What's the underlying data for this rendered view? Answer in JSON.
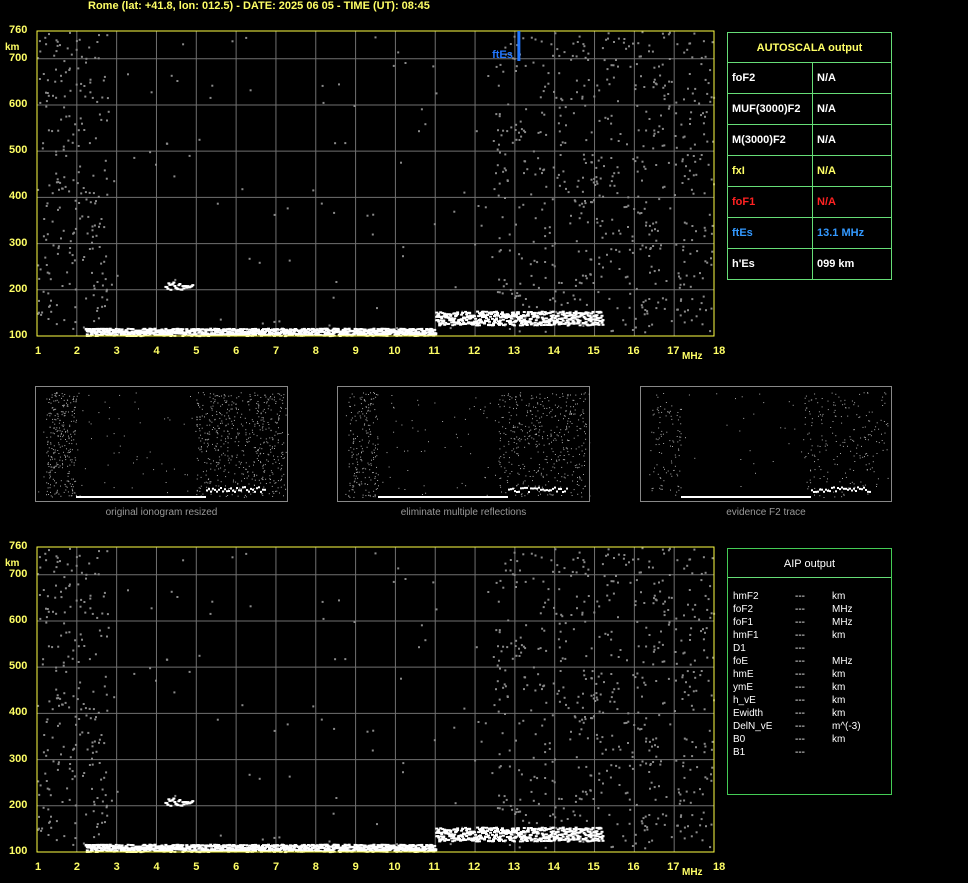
{
  "title": "Rome (lat: +41.8, lon: 012.5) - DATE: 2025 06 05 - TIME (UT): 08:45",
  "axes": {
    "y_unit": "km",
    "x_unit": "MHz",
    "y_ticks": [
      "760",
      "700",
      "600",
      "500",
      "400",
      "300",
      "200",
      "100"
    ],
    "x_ticks": [
      "1",
      "2",
      "3",
      "4",
      "5",
      "6",
      "7",
      "8",
      "9",
      "10",
      "11",
      "12",
      "13",
      "14",
      "15",
      "16",
      "17",
      "18"
    ]
  },
  "colors": {
    "label": "#ffff66",
    "grid": "#707070",
    "frame": "#ffff44",
    "fte": "#2277ff",
    "red": "#ff2222",
    "green": "#66dd77"
  },
  "chart_data": [
    {
      "type": "scatter",
      "name": "ionogram",
      "x_range": [
        1,
        18
      ],
      "y_range": [
        100,
        760
      ],
      "grid": true,
      "annotations": [
        {
          "label": "ftEs",
          "x": 13.1
        }
      ],
      "traces": [
        {
          "x_from": 2.2,
          "x_to": 11.0,
          "height_km": 110
        },
        {
          "x_from": 11.0,
          "x_to": 15.2,
          "height_km": 140
        },
        {
          "x_from": 4.2,
          "x_to": 4.9,
          "height_km": 210
        }
      ]
    },
    {
      "type": "scatter",
      "name": "ionogram-aip",
      "x_range": [
        1,
        18
      ],
      "y_range": [
        100,
        760
      ],
      "grid": true,
      "traces": [
        {
          "x_from": 2.2,
          "x_to": 11.0,
          "height_km": 110
        },
        {
          "x_from": 11.0,
          "x_to": 15.2,
          "height_km": 140
        },
        {
          "x_from": 4.2,
          "x_to": 4.9,
          "height_km": 210
        }
      ]
    }
  ],
  "autoscala": {
    "heading": "AUTOSCALA output",
    "rows": [
      {
        "label": "foF2",
        "value": "N/A",
        "color": "#ffffff"
      },
      {
        "label": "MUF(3000)F2",
        "value": "N/A",
        "color": "#ffffff"
      },
      {
        "label": "M(3000)F2",
        "value": "N/A",
        "color": "#ffffff"
      },
      {
        "label": "fxI",
        "value": "N/A",
        "color": "#ffff66"
      },
      {
        "label": "foF1",
        "value": "N/A",
        "color": "#ff2222"
      },
      {
        "label": "ftEs",
        "value": "13.1  MHz",
        "color": "#3399ff"
      },
      {
        "label": "h'Es",
        "value": "099      km",
        "color": "#ffffff"
      }
    ]
  },
  "thumbnails": [
    {
      "caption": "original ionogram resized"
    },
    {
      "caption": "eliminate multiple reflections"
    },
    {
      "caption": "evidence F2 trace"
    }
  ],
  "aip": {
    "heading": "AIP output",
    "rows": [
      {
        "name": "hmF2",
        "value": "---",
        "unit": "km"
      },
      {
        "name": "foF2",
        "value": "---",
        "unit": "MHz"
      },
      {
        "name": "foF1",
        "value": "---",
        "unit": "MHz"
      },
      {
        "name": "hmF1",
        "value": "---",
        "unit": "km"
      },
      {
        "name": "D1",
        "value": "---",
        "unit": ""
      },
      {
        "name": "foE",
        "value": "---",
        "unit": "MHz"
      },
      {
        "name": "hmE",
        "value": "---",
        "unit": "km"
      },
      {
        "name": "ymE",
        "value": "---",
        "unit": "km"
      },
      {
        "name": "h_vE",
        "value": "---",
        "unit": "km"
      },
      {
        "name": "Ewidth",
        "value": "---",
        "unit": "km"
      },
      {
        "name": "DelN_vE",
        "value": "---",
        "unit": "m^(-3)"
      },
      {
        "name": "B0",
        "value": "---",
        "unit": "km"
      },
      {
        "name": "B1",
        "value": "---",
        "unit": ""
      }
    ]
  }
}
